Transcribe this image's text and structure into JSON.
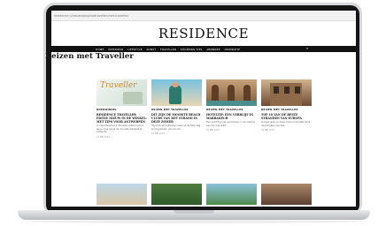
{
  "browser": {
    "url": "residence.nl/reizen/pagina/traveller-met-traveller/"
  },
  "site": {
    "logo": "RESIDENCE"
  },
  "nav": [
    "HOME",
    "INTERIEUR",
    "LIFESTYLE",
    "KUNST",
    "TRAVELLER",
    "SHOPPING TIPS",
    "ABONNEE",
    "INSPIRATIE"
  ],
  "page": {
    "heading": "Reizen met Traveller"
  },
  "cards": [
    {
      "category": "BOEKWINKEL",
      "title": "RESIDENCE TRAVELLER EDITIE NIEUW IN DE WINKEL: MET TIPS VOOR ANTWERPEN",
      "excerpt": "In deze Residence Traveller editie nemen we je mee langs de mooiste adresjes en hotspots.",
      "date": "16 MEI 2023"
    },
    {
      "category": "REIZEN MET TRAVELLER",
      "title": "DIT ZIJN DE MOOISTE BEACH CLUBS VAN HET STRAND IN DEZE ZOMER",
      "excerpt": "Stijlvolle strandtenten waar je de hele dag kunt genieten van de zon.",
      "date": "16 MEI 2023"
    },
    {
      "category": "REIZEN MET TRAVELLER",
      "title": "HOTELTIP: EEN VERBLIJF IN MARRAKECH",
      "excerpt": "Een prachtig riad verscholen in de medina van de rode stad.",
      "date": "15 MEI 2023"
    },
    {
      "category": "REIZEN MET TRAVELLER",
      "title": "TOP 10 VAN DE BESTE STRANDEN VAN EUROPA",
      "excerpt": "Ontdek waar je deze zomer het beste kunt neerstrijken aan zee.",
      "date": "15 MEI 2023"
    }
  ]
}
